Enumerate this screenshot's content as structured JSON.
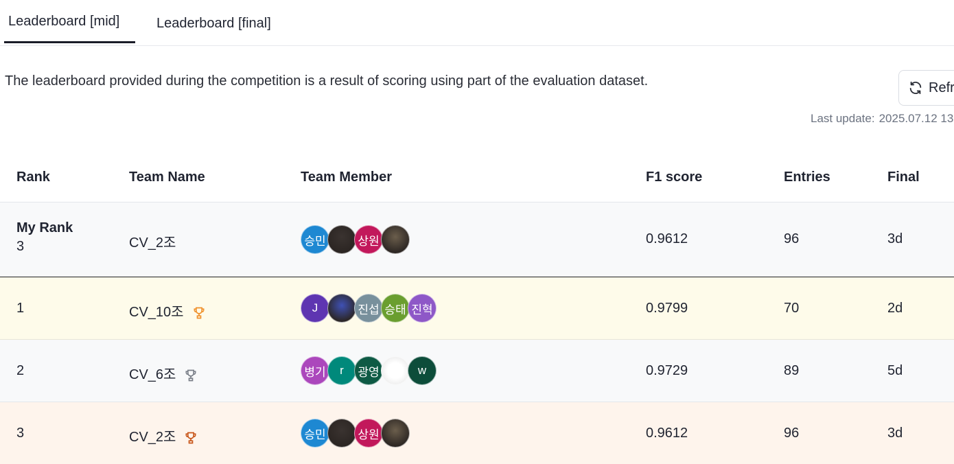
{
  "tabs": [
    {
      "label": "Leaderboard [mid]",
      "active": true
    },
    {
      "label": "Leaderboard [final]",
      "active": false
    }
  ],
  "description": "The leaderboard provided during the competition is a result of scoring using part of the evaluation dataset.",
  "refresh": {
    "label": "Refr",
    "icon": "refresh-icon"
  },
  "last_update": {
    "label": "Last update:",
    "value": "2025.07.12 13"
  },
  "columns": [
    "Rank",
    "Team Name",
    "Team Member",
    "F1 score",
    "Entries",
    "Final"
  ],
  "my_rank": {
    "label": "My Rank",
    "rank": "3",
    "team": "CV_2조",
    "f1": "0.9612",
    "entries": "96",
    "final": "3d",
    "members": [
      {
        "text": "승민",
        "color": "#1e88d2"
      },
      {
        "text": "",
        "color": "#3a3330",
        "photo": true
      },
      {
        "text": "상원",
        "color": "#c2185b"
      },
      {
        "text": "",
        "color": "#6b5e4c",
        "photo": true
      }
    ]
  },
  "rows": [
    {
      "rank": "1",
      "team": "CV_10조",
      "trophy_color": "#f0902a",
      "f1": "0.9799",
      "entries": "70",
      "final": "2d",
      "members": [
        {
          "text": "J",
          "color": "#5e35b1"
        },
        {
          "text": "",
          "color": "#3f51b5",
          "photo": true
        },
        {
          "text": "진섭",
          "color": "#78909c"
        },
        {
          "text": "승태",
          "color": "#6a9e2f"
        },
        {
          "text": "진혁",
          "color": "#8e58c7"
        }
      ]
    },
    {
      "rank": "2",
      "team": "CV_6조",
      "trophy_color": "#7a7f88",
      "f1": "0.9729",
      "entries": "89",
      "final": "5d",
      "members": [
        {
          "text": "병기",
          "color": "#ab47bc"
        },
        {
          "text": "r",
          "color": "#00897b"
        },
        {
          "text": "광영",
          "color": "#0e5a44"
        },
        {
          "text": "",
          "color": "#f4f4f4",
          "photo": true
        },
        {
          "text": "w",
          "color": "#0d4d3a"
        }
      ]
    },
    {
      "rank": "3",
      "team": "CV_2조",
      "trophy_color": "#c8561a",
      "f1": "0.9612",
      "entries": "96",
      "final": "3d",
      "members": [
        {
          "text": "승민",
          "color": "#1e88d2"
        },
        {
          "text": "",
          "color": "#3a3330",
          "photo": true
        },
        {
          "text": "상원",
          "color": "#c2185b"
        },
        {
          "text": "",
          "color": "#6b5e4c",
          "photo": true
        }
      ]
    }
  ]
}
